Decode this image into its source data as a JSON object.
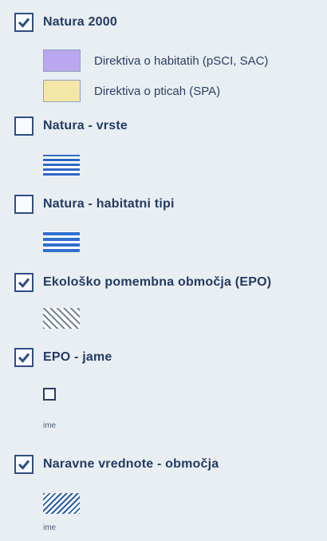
{
  "layers": [
    {
      "title": "Natura 2000",
      "checked": true
    },
    {
      "title": "Natura - vrste",
      "checked": false
    },
    {
      "title": "Natura - habitatni tipi",
      "checked": false
    },
    {
      "title": "Ekološko pomembna območja (EPO)",
      "checked": true
    },
    {
      "title": "EPO - jame",
      "checked": true
    },
    {
      "title": "Naravne vrednote - območja",
      "checked": true
    }
  ],
  "natura2000_legend": [
    {
      "label": "Direktiva o habitatih (pSCI, SAC)",
      "color": "#b9a7ef"
    },
    {
      "label": "Direktiva o pticah (SPA)",
      "color": "#f4e6a6"
    }
  ],
  "epo_jame_label": "ime",
  "naravne_vrednote_label": "ime",
  "colors": {
    "checkbox_border": "#2f4d86",
    "checkmark": "#2f4d86",
    "text": "#233b63"
  }
}
